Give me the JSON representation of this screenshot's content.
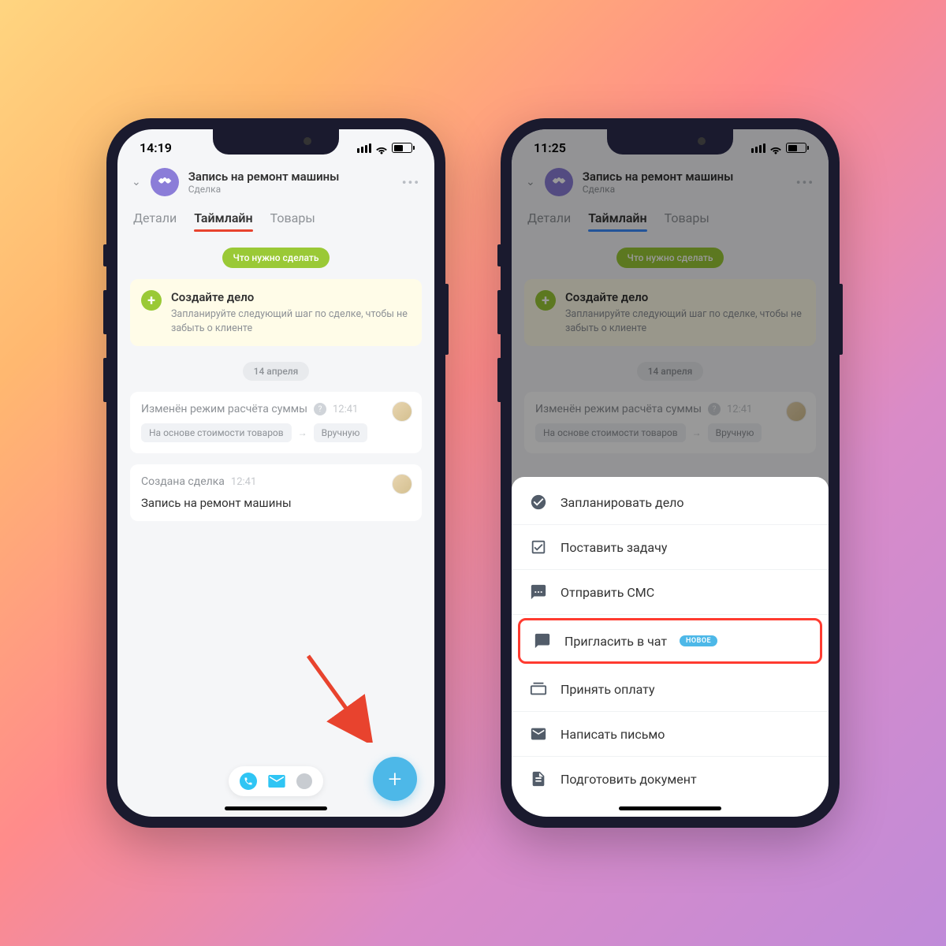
{
  "left": {
    "status_time": "14:19",
    "header": {
      "title": "Запись на ремонт машины",
      "subtitle": "Сделка"
    },
    "tabs": {
      "details": "Детали",
      "timeline": "Таймлайн",
      "products": "Товары"
    },
    "todo_pill": "Что нужно сделать",
    "create_card": {
      "title": "Создайте дело",
      "sub": "Запланируйте следующий шаг по сделке, чтобы не забыть о клиенте"
    },
    "date": "14 апреля",
    "event1": {
      "title": "Изменён режим расчёта суммы",
      "time": "12:41",
      "tag_from": "На основе стоимости товаров",
      "tag_to": "Вручную"
    },
    "event2": {
      "title": "Создана сделка",
      "time": "12:41",
      "body": "Запись на ремонт машины"
    }
  },
  "right": {
    "status_time": "11:25",
    "header": {
      "title": "Запись на ремонт машины",
      "subtitle": "Сделка"
    },
    "tabs": {
      "details": "Детали",
      "timeline": "Таймлайн",
      "products": "Товары"
    },
    "todo_pill": "Что нужно сделать",
    "create_card": {
      "title": "Создайте дело",
      "sub": "Запланируйте следующий шаг по сделке, чтобы не забыть о клиенте"
    },
    "date": "14 апреля",
    "event1": {
      "title": "Изменён режим расчёта суммы",
      "time": "12:41",
      "tag_from": "На основе стоимости товаров",
      "tag_to": "Вручную"
    },
    "actions": {
      "plan": "Запланировать дело",
      "task": "Поставить задачу",
      "sms": "Отправить СМС",
      "chat": "Пригласить в чат",
      "chat_badge": "НОВОЕ",
      "payment": "Принять оплату",
      "email": "Написать письмо",
      "document": "Подготовить документ"
    }
  }
}
